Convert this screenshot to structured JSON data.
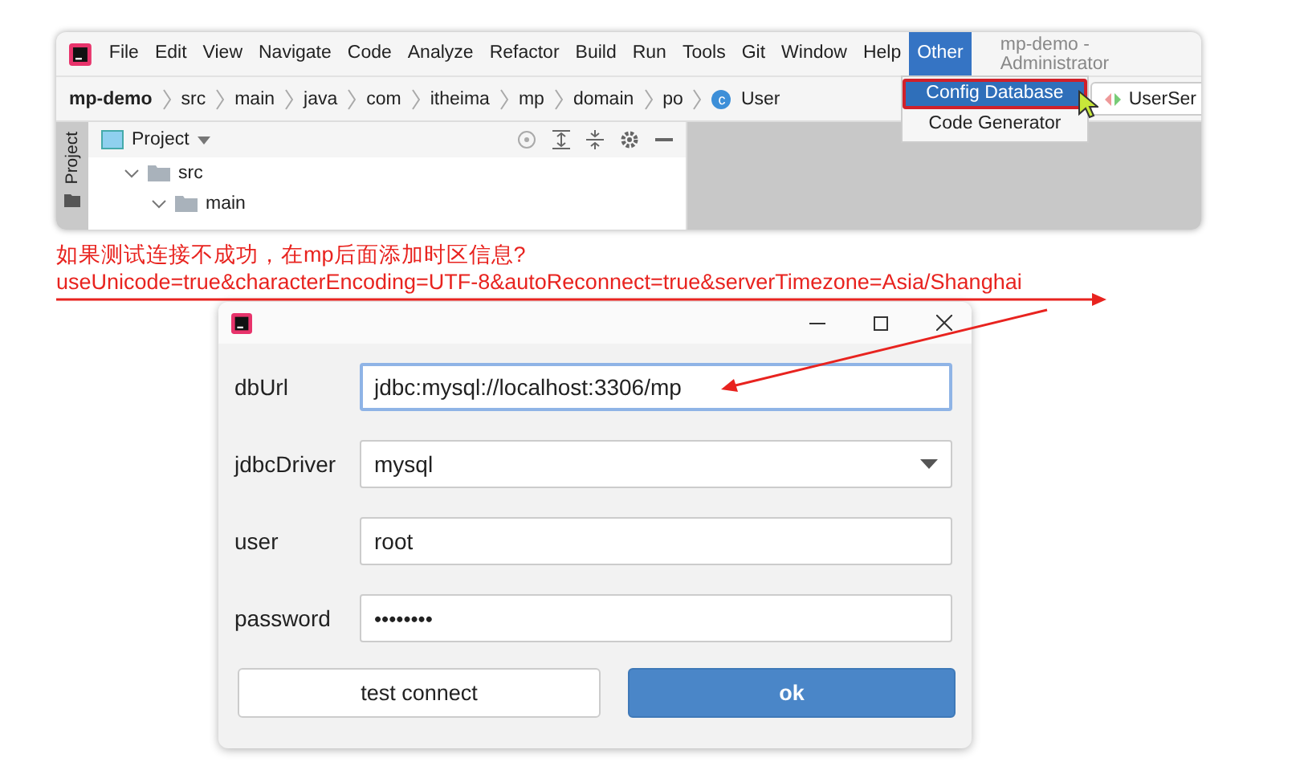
{
  "ide": {
    "menu": [
      {
        "label": "File",
        "selected": false
      },
      {
        "label": "Edit",
        "selected": false
      },
      {
        "label": "View",
        "selected": false
      },
      {
        "label": "Navigate",
        "selected": false
      },
      {
        "label": "Code",
        "selected": false
      },
      {
        "label": "Analyze",
        "selected": false
      },
      {
        "label": "Refactor",
        "selected": false
      },
      {
        "label": "Build",
        "selected": false
      },
      {
        "label": "Run",
        "selected": false
      },
      {
        "label": "Tools",
        "selected": false
      },
      {
        "label": "Git",
        "selected": false
      },
      {
        "label": "Window",
        "selected": false
      },
      {
        "label": "Help",
        "selected": false
      },
      {
        "label": "Other",
        "selected": true
      }
    ],
    "title": "mp-demo - Administrator",
    "breadcrumbs": [
      "mp-demo",
      "src",
      "main",
      "java",
      "com",
      "itheima",
      "mp",
      "domain",
      "po"
    ],
    "current_file": {
      "badge": "c",
      "name": "User"
    },
    "editor_tab": "UserSer",
    "dropdown": [
      {
        "label": "Config Database",
        "selected": true
      },
      {
        "label": "Code Generator",
        "selected": false
      }
    ],
    "side_tab": "Project",
    "project_header": "Project",
    "tree": [
      {
        "label": "src",
        "expanded": true,
        "children": [
          {
            "label": "main",
            "expanded": true
          }
        ]
      }
    ]
  },
  "annotation": {
    "lines": [
      "如果测试连接不成功，在mp后面添加时区信息?",
      "useUnicode=true&characterEncoding=UTF-8&autoReconnect=true&serverTimezone=Asia/Shanghai"
    ]
  },
  "dialog": {
    "fields": [
      {
        "kind": "text",
        "label": "dbUrl",
        "value": "jdbc:mysql://localhost:3306/mp",
        "focused": true
      },
      {
        "kind": "select",
        "label": "jdbcDriver",
        "value": "mysql",
        "focused": false
      },
      {
        "kind": "text",
        "label": "user",
        "value": "root",
        "focused": false
      },
      {
        "kind": "password",
        "label": "password",
        "value": "••••••••",
        "focused": false
      }
    ],
    "buttons": [
      {
        "label": "test connect",
        "primary": false
      },
      {
        "label": "ok",
        "primary": true
      }
    ]
  }
}
